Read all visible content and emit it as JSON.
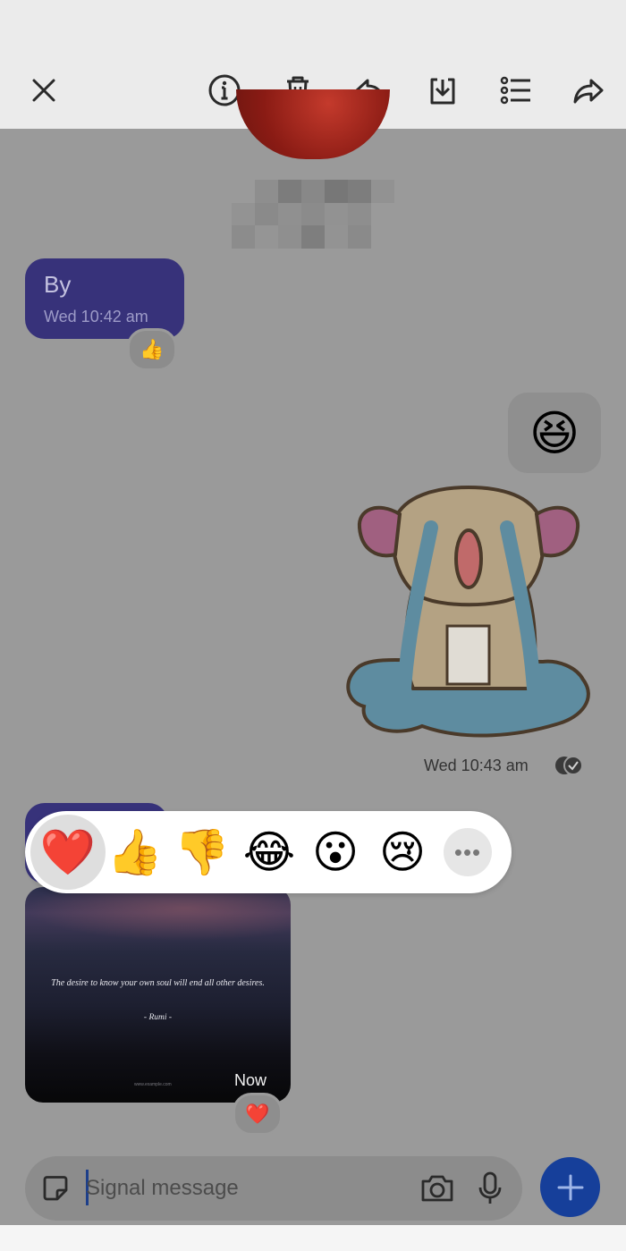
{
  "toolbar": {
    "icons": [
      "close-icon",
      "info-icon",
      "delete-icon",
      "reply-icon",
      "download-icon",
      "select-multiple-icon",
      "forward-icon"
    ]
  },
  "conversation": {
    "incoming": {
      "text": "By",
      "time": "Wed 10:42 am",
      "reaction": "👍"
    },
    "outgoing_emoji": "😆",
    "outgoing_time": "Wed 10:43 am",
    "photo": {
      "quote": "The desire to know your own soul will end all other desires.",
      "author": "- Rumi -",
      "credit": "www.example.com",
      "time": "Now",
      "reaction": "❤️"
    }
  },
  "reaction_picker": {
    "options": [
      "❤️",
      "👍",
      "👎",
      "😂",
      "😮",
      "😢"
    ],
    "selected_index": 0,
    "more_label": "•••"
  },
  "composer": {
    "placeholder": "Signal message"
  },
  "colors": {
    "toolbar": "#ebebeb",
    "dim_background": "#9a9a9a",
    "incoming_bubble": "#37327a",
    "fab": "#163f9a"
  }
}
